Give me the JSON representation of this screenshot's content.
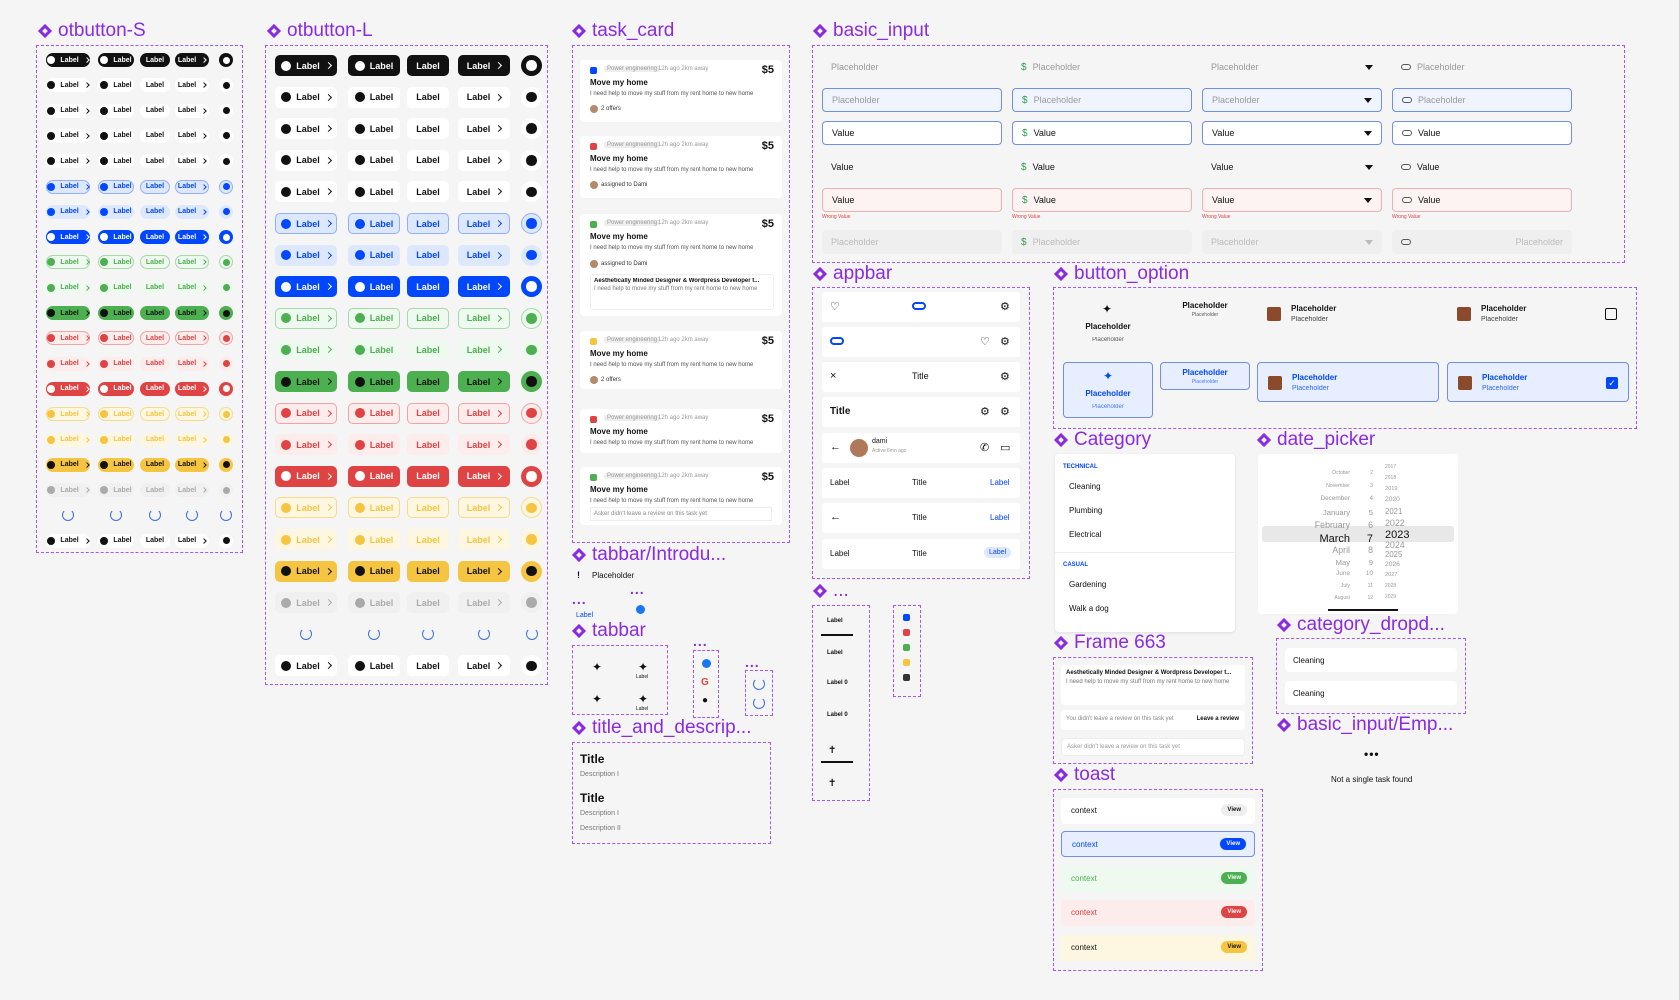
{
  "sections": {
    "otbutton_s": "otbutton-S",
    "otbutton_l": "otbutton-L",
    "task_card": "task_card",
    "basic_input": "basic_input",
    "appbar": "appbar",
    "button_option": "button_option",
    "category": "Category",
    "date_picker": "date_picker",
    "tabbar_intro": "tabbar/Introdu...",
    "tabbar": "tabbar",
    "title_and_desc": "title_and_descrip...",
    "frame663": "Frame 663",
    "category_dropdown": "category_dropd...",
    "basic_input_empty": "basic_input/Emp...",
    "toast": "toast",
    "more": "..."
  },
  "button": {
    "label": "Label"
  },
  "task_cards": [
    {
      "tag": "Power engineering",
      "meta": "12h ago  2km away",
      "price": "$5",
      "title": "Move my home",
      "desc": "I need help to move my stuff from my rent home to new home",
      "footer": "2 offers"
    },
    {
      "tag": "Power engineering",
      "meta": "12h ago  2km away",
      "price": "$5",
      "title": "Move my home",
      "desc": "I need help to move my stuff from my rent home to new home",
      "footer": "assigned to Dami"
    },
    {
      "tag": "Power engineering",
      "meta": "12h ago  2km away",
      "price": "$5",
      "title": "Move my home",
      "desc": "I need help to move my stuff from my rent home to new home",
      "footer": "assigned to Dami",
      "sub_title": "Aesthetically Minded Designer & Wordpress Developer t...",
      "sub_desc": "I need help to move my stuff from my rent home to new home"
    },
    {
      "tag": "Power engineering",
      "meta": "12h ago  2km away",
      "price": "$5",
      "title": "Move my home",
      "desc": "I need help to move my stuff from my rent home to new home",
      "footer": "2 offers"
    },
    {
      "tag": "Power engineering",
      "meta": "12h ago  2km away",
      "price": "$5",
      "title": "Move my home",
      "desc": "I need help to move my stuff from my rent home to new home",
      "footer": ""
    },
    {
      "tag": "Power engineering",
      "meta": "12h ago  2km away",
      "price": "$5",
      "title": "Move my home",
      "desc": "I need help to move my stuff from my rent home to new home",
      "footer": "Asker didn't leave a review on this task yet"
    }
  ],
  "inputs": {
    "placeholder": "Placeholder",
    "value": "Value",
    "wrong": "Wrong Value",
    "dollar": "$"
  },
  "appbar": {
    "title": "Title",
    "label": "Label",
    "user": "dami",
    "status": "Active 6mn ago"
  },
  "button_option": {
    "placeholder": "Placeholder"
  },
  "category": {
    "group1": "TECHNICAL",
    "items1": [
      "Cleaning",
      "Plumbing",
      "Electrical"
    ],
    "group2": "CASUAL",
    "items2": [
      "Gardening",
      "Walk a dog"
    ]
  },
  "date_picker": {
    "months": [
      "October",
      "November",
      "December",
      "January",
      "February",
      "March",
      "April",
      "May",
      "June",
      "July",
      "August"
    ],
    "days": [
      "2",
      "3",
      "4",
      "5",
      "6",
      "7",
      "8",
      "9",
      "10",
      "11",
      "12"
    ],
    "years": [
      "2017",
      "2018",
      "2019",
      "2020",
      "2021",
      "2022",
      "2023",
      "2024",
      "2025",
      "2026",
      "2027",
      "2028",
      "2029"
    ]
  },
  "tabbar_intro": {
    "placeholder": "Placeholder",
    "label": "Label",
    "bang": "!"
  },
  "title_desc": {
    "title": "Title",
    "desc1": "Description I",
    "desc2": "Description II"
  },
  "frame663": {
    "title": "Aesthetically Minded Designer & Wordpress Developer t...",
    "desc": "I need help to move my stuff from my rent home to new home",
    "no_review": "You didn't leave a review on this task yet",
    "leave": "Leave a review",
    "asker": "Asker didn't leave a review on this task yet"
  },
  "category_dropdown": {
    "items": [
      "Cleaning",
      "Cleaning"
    ]
  },
  "empty": {
    "text": "Not a single task found",
    "dots": "•••"
  },
  "toast": {
    "context": "context",
    "view": "View"
  },
  "tab_labels": {
    "label_0": "Label  0"
  },
  "colors": {
    "accent": "#8a2be2",
    "blue": "#0047ff",
    "green": "#4caf50",
    "red": "#e04343",
    "yellow": "#f5c542",
    "black": "#111111"
  }
}
